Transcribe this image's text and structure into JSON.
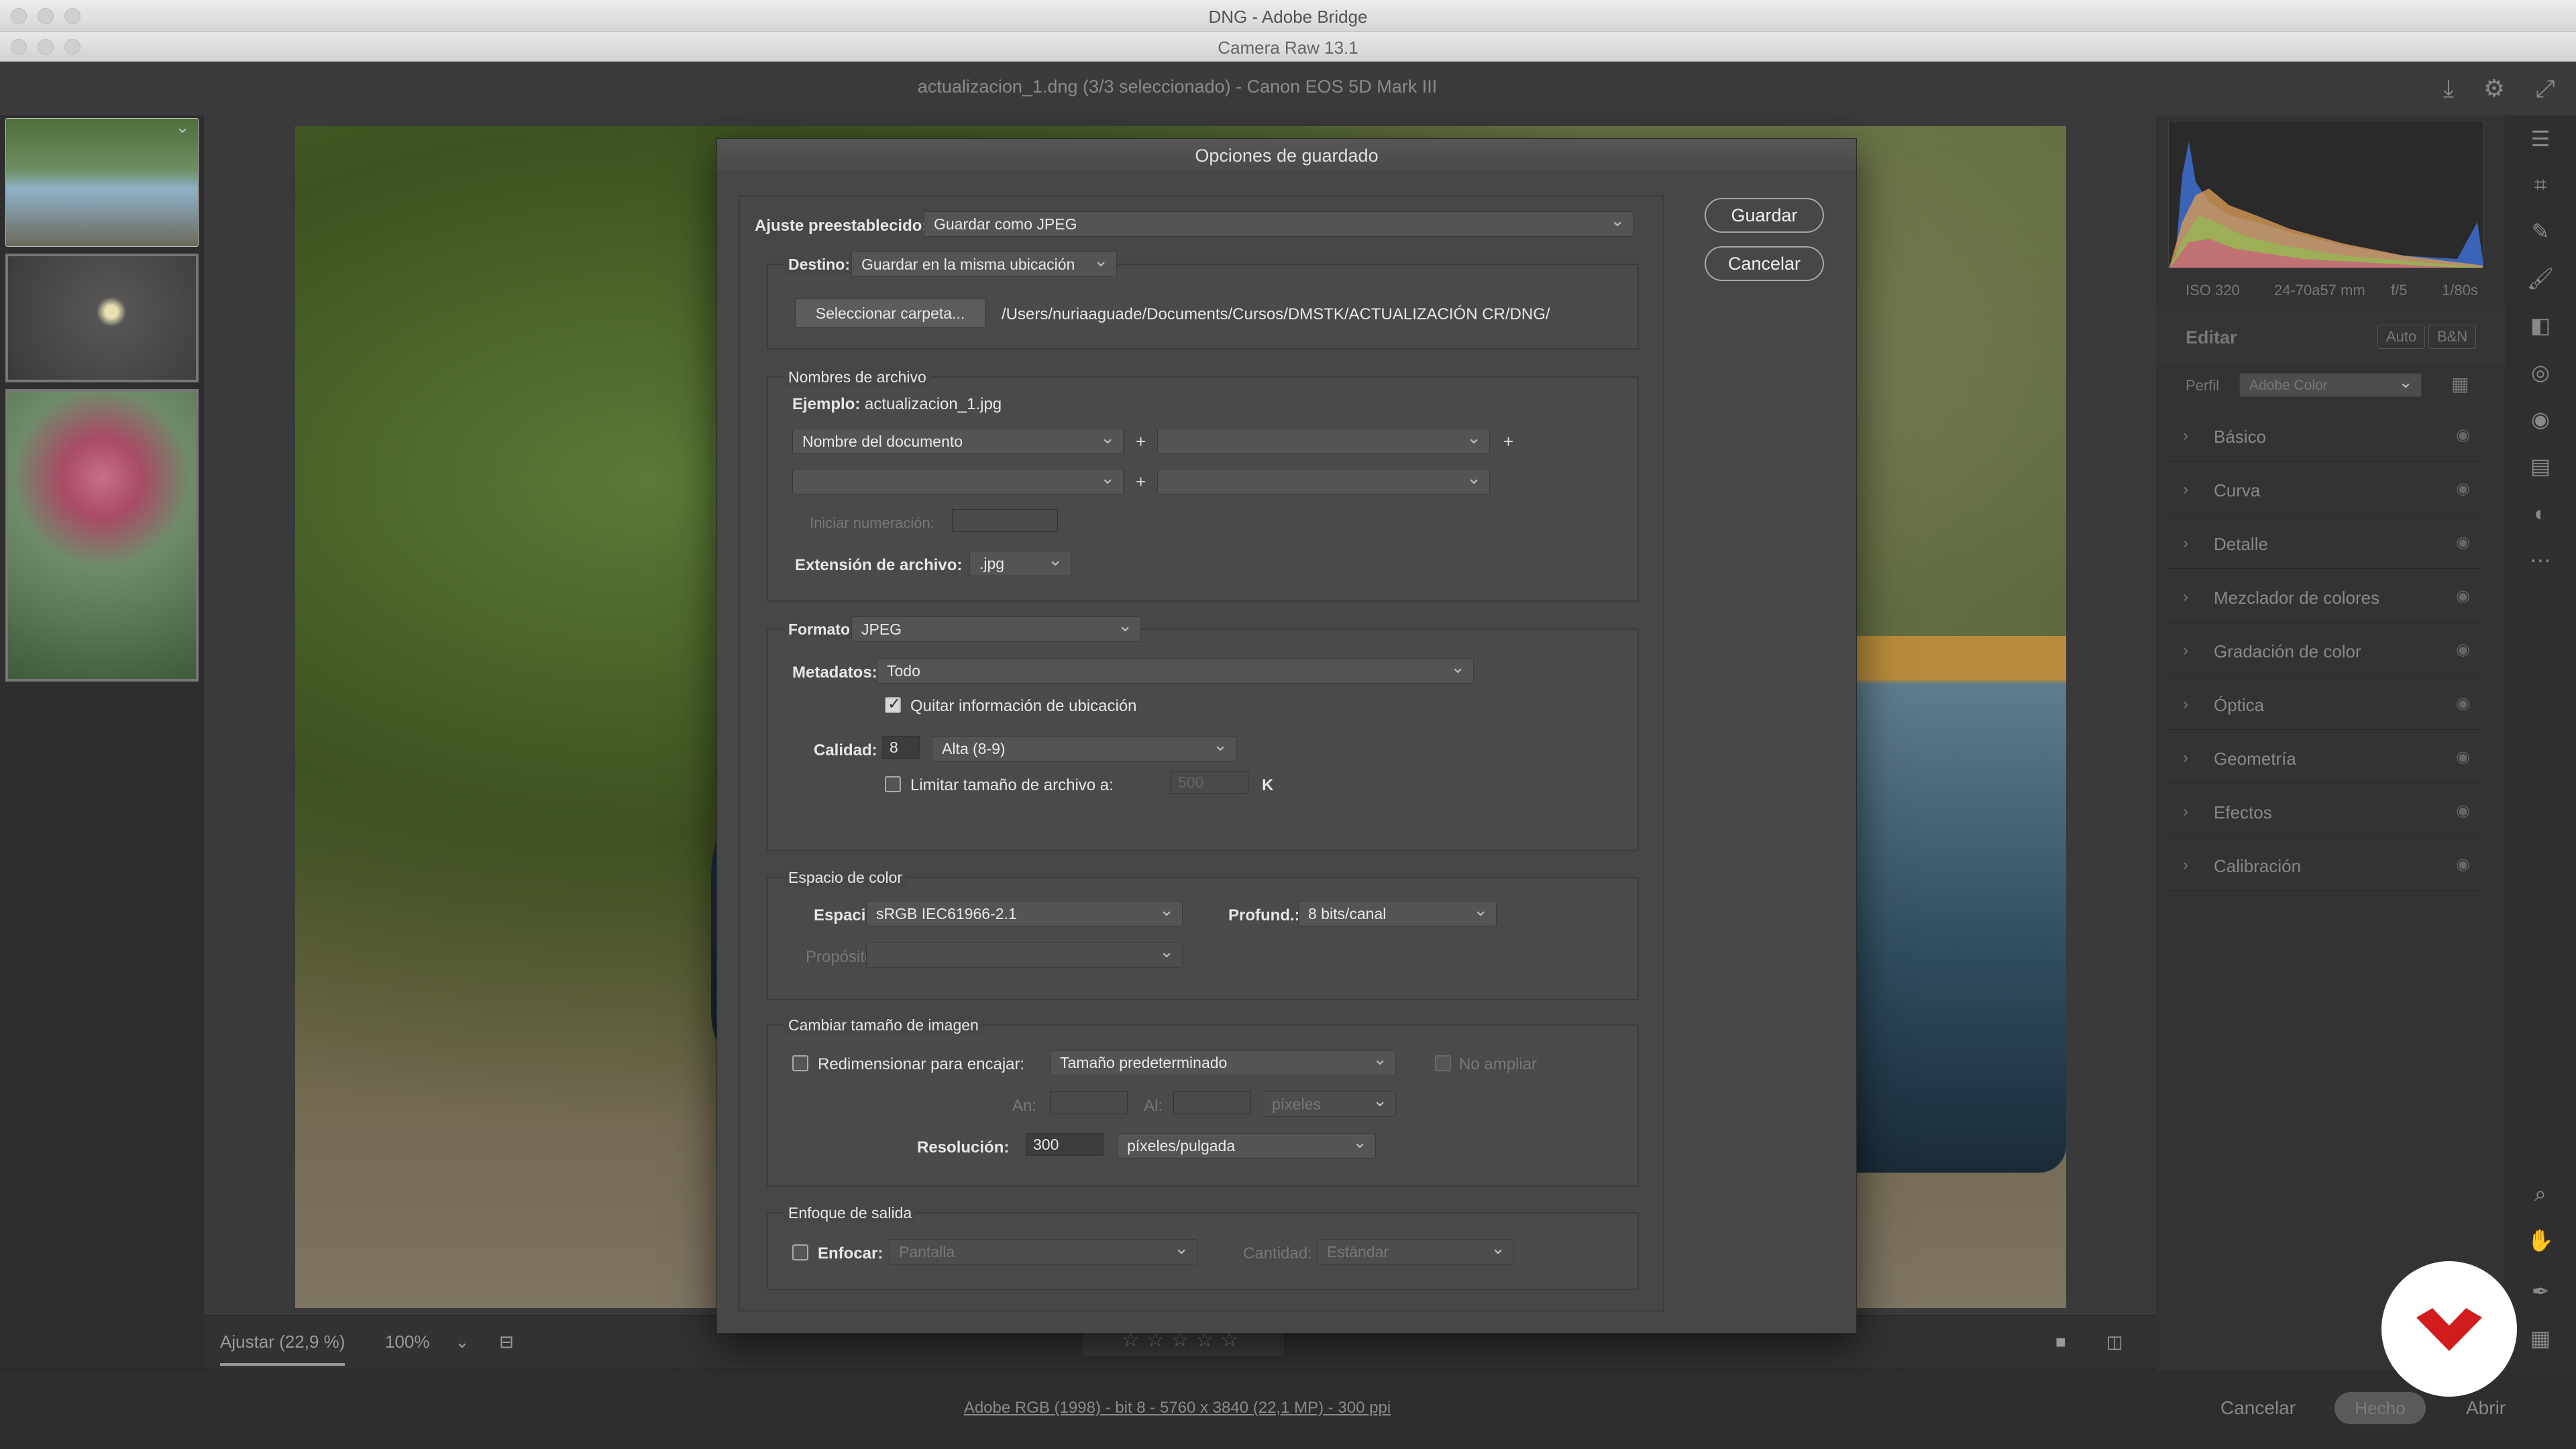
{
  "window": {
    "bridge_title": "DNG - Adobe Bridge",
    "cr_title": "Camera Raw 13.1",
    "doc_title": "actualizacion_1.dng (3/3 seleccionado) -  Canon EOS 5D Mark III"
  },
  "bottom": {
    "fit_label": "Ajustar (22,9 %)",
    "zoom_label": "100%",
    "stars": "☆☆☆☆☆"
  },
  "status": {
    "info_link": "Adobe RGB (1998) - bit 8 - 5760 x 3840 (22,1 MP) - 300 ppi",
    "cancel": "Cancelar",
    "done": "Hecho",
    "open": "Abrir"
  },
  "right_panel": {
    "exif": [
      "ISO 320",
      "24-70a57 mm",
      "f/5",
      "1/80s"
    ],
    "edit_title": "Editar",
    "auto": "Auto",
    "bw": "B&N",
    "profile_label": "Perfil",
    "profile_value": "Adobe Color",
    "sections": [
      "Básico",
      "Curva",
      "Detalle",
      "Mezclador de colores",
      "Gradación de color",
      "Óptica",
      "Geometría",
      "Efectos",
      "Calibración"
    ]
  },
  "dialog": {
    "title": "Opciones de guardado",
    "save": "Guardar",
    "cancel": "Cancelar",
    "preset_label": "Ajuste preestablecido:",
    "preset_value": "Guardar como JPEG",
    "dest": {
      "label": "Destino:",
      "value": "Guardar en la misma ubicación",
      "select_folder": "Seleccionar carpeta...",
      "path": "/Users/nuriaaguade/Documents/Cursos/DMSTK/ACTUALIZACIÓN CR/DNG/"
    },
    "filenames": {
      "title": "Nombres de archivo",
      "example_label": "Ejemplo:",
      "example_value": "actualizacion_1.jpg",
      "field1": "Nombre del documento",
      "field2": "",
      "field3": "",
      "field4": "",
      "plus": "+",
      "start_num_label": "Iniciar numeración:",
      "ext_label": "Extensión de archivo:",
      "ext_value": ".jpg"
    },
    "format": {
      "label": "Formato:",
      "value": "JPEG",
      "meta_label": "Metadatos:",
      "meta_value": "Todo",
      "remove_location": "Quitar información de ubicación",
      "quality_label": "Calidad:",
      "quality_value": "8",
      "quality_preset": "Alta  (8-9)",
      "limit_label": "Limitar tamaño de archivo a:",
      "limit_value": "500",
      "limit_unit": "K"
    },
    "color": {
      "title": "Espacio de color",
      "space_label": "Espacio:",
      "space_value": "sRGB IEC61966-2.1",
      "depth_label": "Profund.:",
      "depth_value": "8 bits/canal",
      "intent_label": "Propósito:"
    },
    "resize": {
      "title": "Cambiar tamaño de imagen",
      "fit_label": "Redimensionar para encajar:",
      "fit_value": "Tamaño predeterminado",
      "no_enlarge": "No ampliar",
      "w_label": "An:",
      "h_label": "Al:",
      "unit": "píxeles",
      "res_label": "Resolución:",
      "res_value": "300",
      "res_unit": "píxeles/pulgada"
    },
    "sharpen": {
      "title": "Enfoque de salida",
      "label": "Enfocar:",
      "value": "Pantalla",
      "amount_label": "Cantidad:",
      "amount_value": "Estándar"
    }
  }
}
